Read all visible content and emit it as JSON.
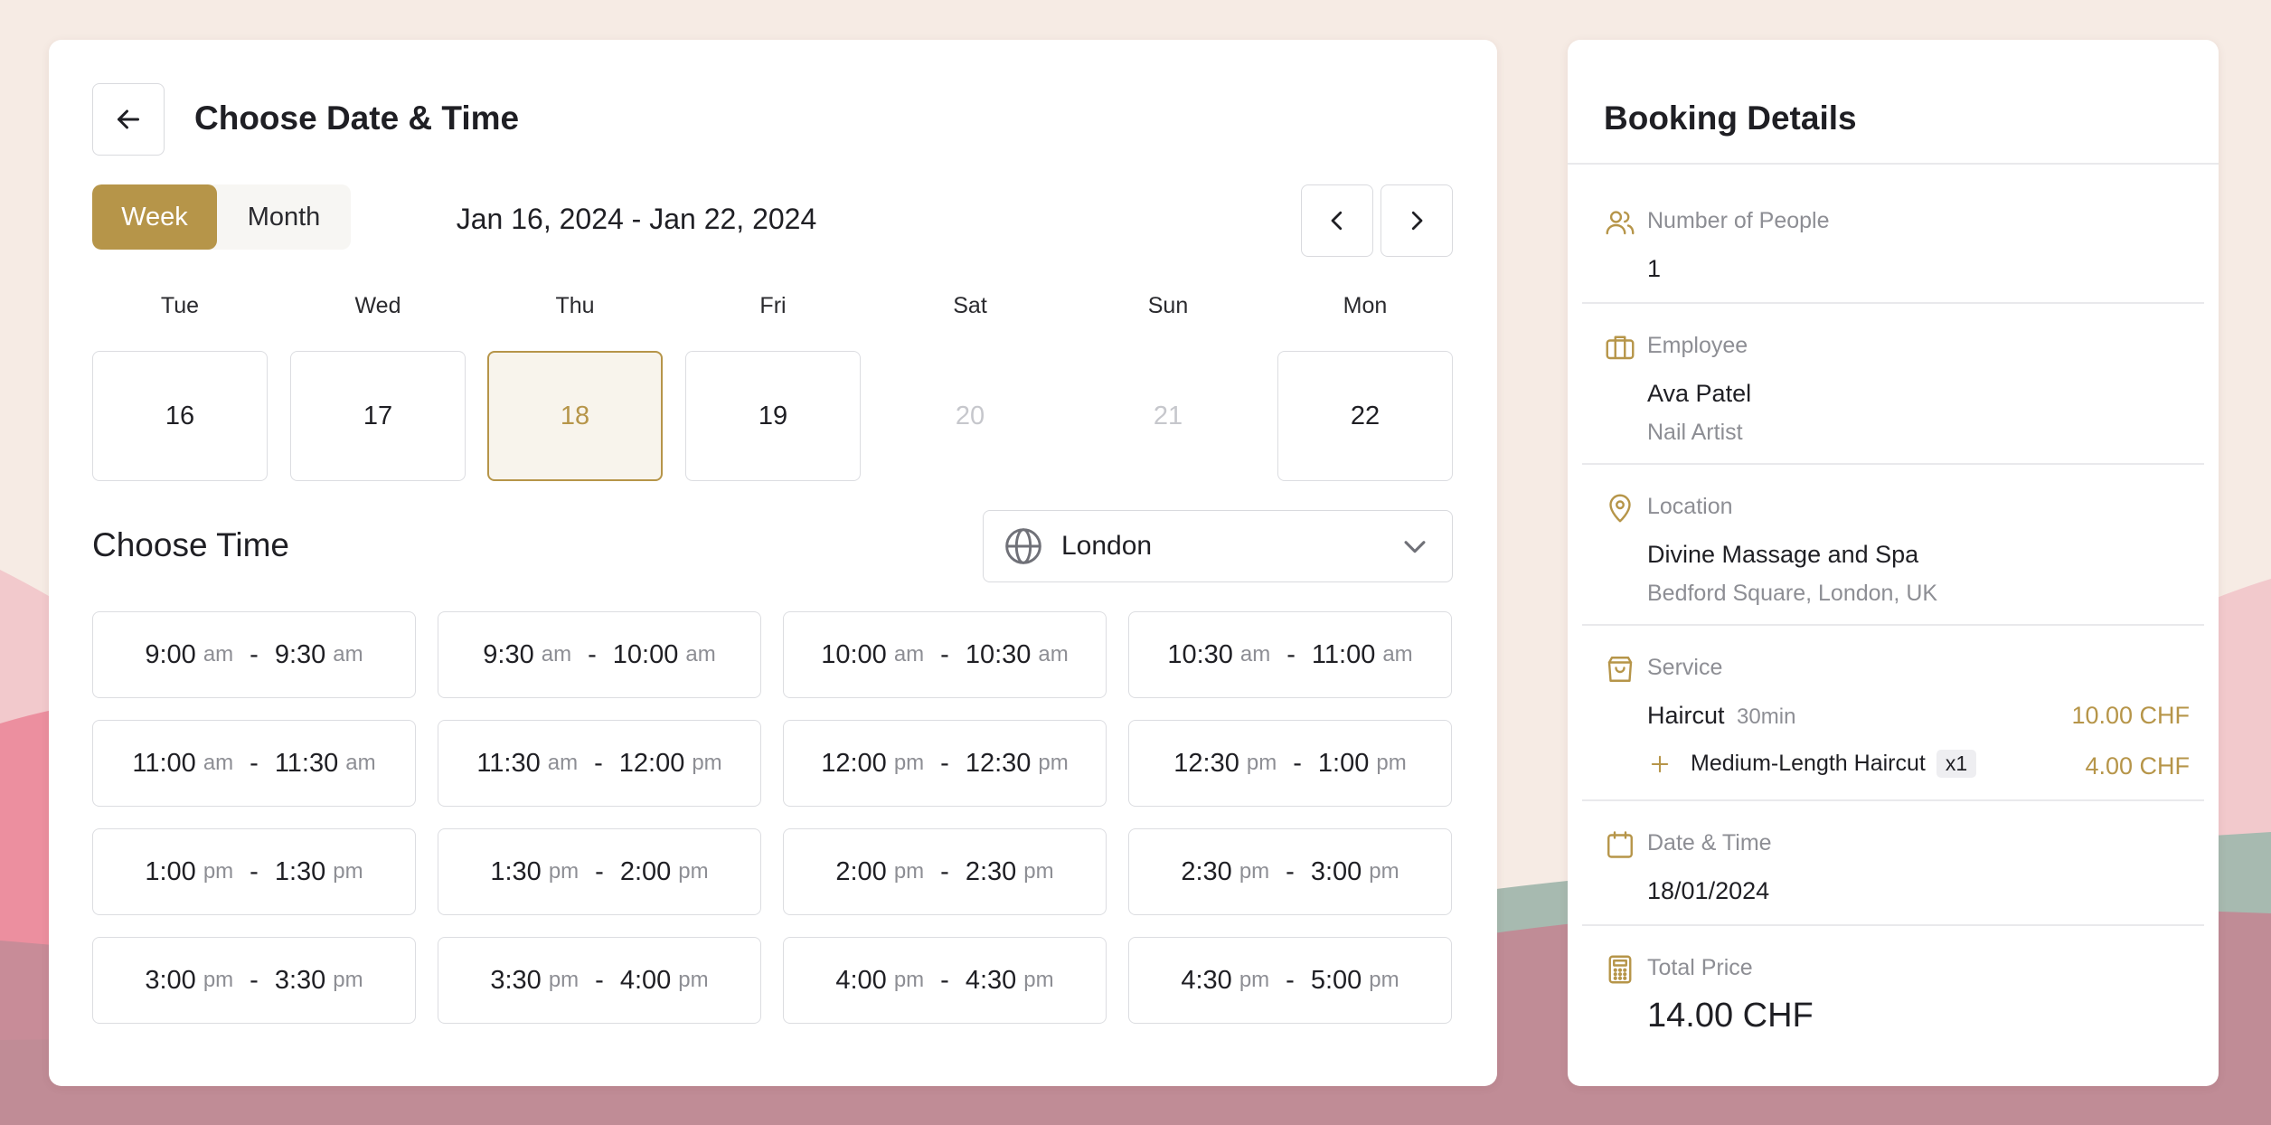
{
  "header": {
    "title": "Choose Date & Time"
  },
  "view_toggle": {
    "week": "Week",
    "month": "Month"
  },
  "date_range": "Jan 16, 2024 - Jan 22, 2024",
  "days": [
    {
      "name": "Tue",
      "num": "16"
    },
    {
      "name": "Wed",
      "num": "17"
    },
    {
      "name": "Thu",
      "num": "18"
    },
    {
      "name": "Fri",
      "num": "19"
    },
    {
      "name": "Sat",
      "num": "20"
    },
    {
      "name": "Sun",
      "num": "21"
    },
    {
      "name": "Mon",
      "num": "22"
    }
  ],
  "time_section": {
    "title": "Choose Time",
    "timezone": "London"
  },
  "slots": [
    {
      "start": "9:00",
      "sp": "am",
      "end": "9:30",
      "ep": "am"
    },
    {
      "start": "9:30",
      "sp": "am",
      "end": "10:00",
      "ep": "am"
    },
    {
      "start": "10:00",
      "sp": "am",
      "end": "10:30",
      "ep": "am"
    },
    {
      "start": "10:30",
      "sp": "am",
      "end": "11:00",
      "ep": "am"
    },
    {
      "start": "11:00",
      "sp": "am",
      "end": "11:30",
      "ep": "am"
    },
    {
      "start": "11:30",
      "sp": "am",
      "end": "12:00",
      "ep": "pm"
    },
    {
      "start": "12:00",
      "sp": "pm",
      "end": "12:30",
      "ep": "pm"
    },
    {
      "start": "12:30",
      "sp": "pm",
      "end": "1:00",
      "ep": "pm"
    },
    {
      "start": "1:00",
      "sp": "pm",
      "end": "1:30",
      "ep": "pm"
    },
    {
      "start": "1:30",
      "sp": "pm",
      "end": "2:00",
      "ep": "pm"
    },
    {
      "start": "2:00",
      "sp": "pm",
      "end": "2:30",
      "ep": "pm"
    },
    {
      "start": "2:30",
      "sp": "pm",
      "end": "3:00",
      "ep": "pm"
    },
    {
      "start": "3:00",
      "sp": "pm",
      "end": "3:30",
      "ep": "pm"
    },
    {
      "start": "3:30",
      "sp": "pm",
      "end": "4:00",
      "ep": "pm"
    },
    {
      "start": "4:00",
      "sp": "pm",
      "end": "4:30",
      "ep": "pm"
    },
    {
      "start": "4:30",
      "sp": "pm",
      "end": "5:00",
      "ep": "pm"
    }
  ],
  "details": {
    "title": "Booking Details",
    "people": {
      "label": "Number of People",
      "value": "1"
    },
    "employee": {
      "label": "Employee",
      "name": "Ava Patel",
      "role": "Nail Artist"
    },
    "location": {
      "label": "Location",
      "name": "Divine Massage and Spa",
      "address": "Bedford Square, London, UK"
    },
    "service": {
      "label": "Service",
      "name": "Haircut",
      "duration": "30min",
      "price": "10.00 CHF",
      "addon_name": "Medium-Length Haircut",
      "addon_qty": "x1",
      "addon_price": "4.00 CHF"
    },
    "datetime": {
      "label": "Date & Time",
      "value": "18/01/2024"
    },
    "total": {
      "label": "Total Price",
      "value": "14.00 CHF"
    }
  },
  "colors": {
    "accent": "#b69549",
    "border": "#dcdde1",
    "muted": "#8d8e94",
    "selected_bg": "#f8f4ec"
  }
}
